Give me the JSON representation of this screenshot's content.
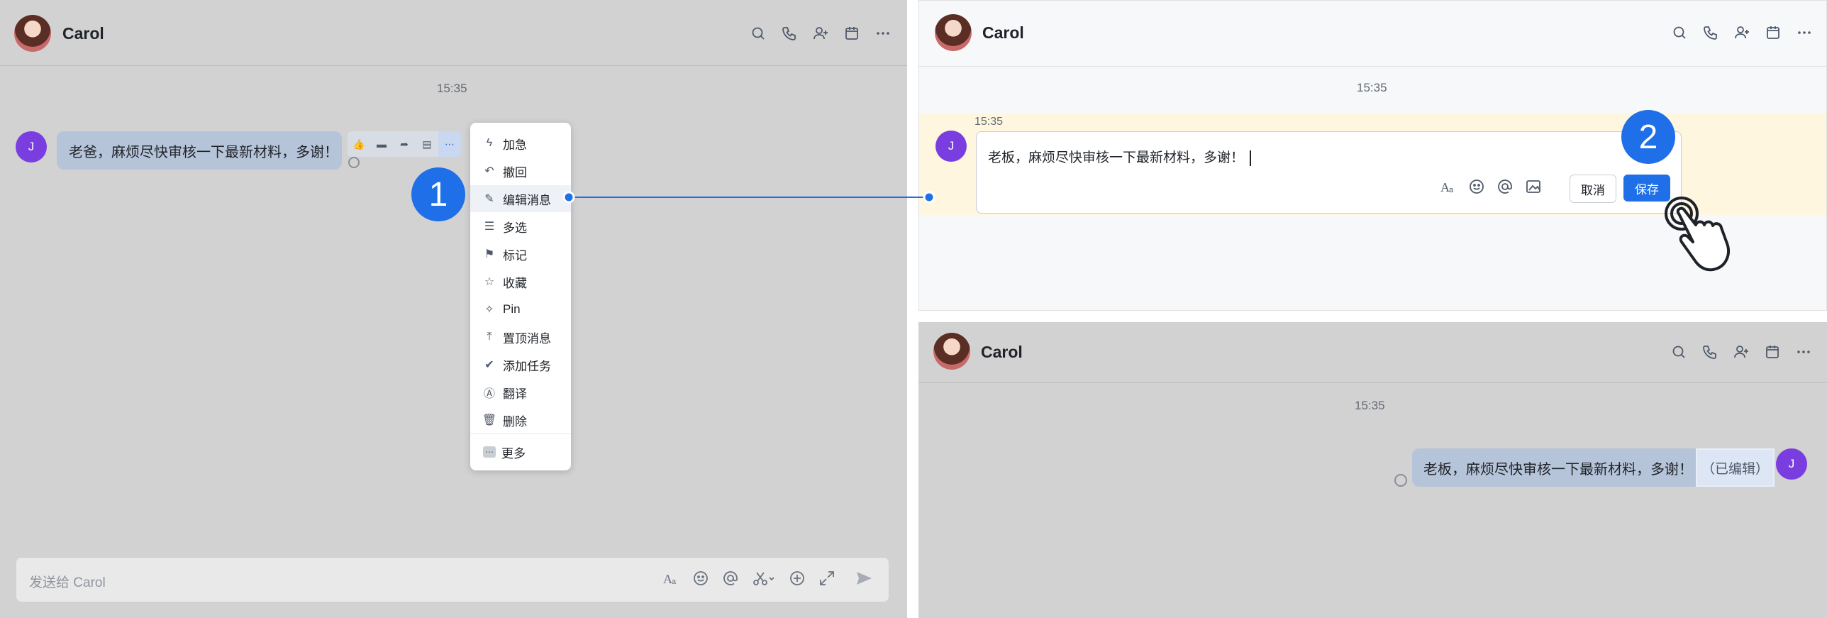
{
  "contact_name": "Carol",
  "time": "15:35",
  "time_small": "15:35",
  "avatar_initial": "J",
  "step_labels": [
    "1",
    "2"
  ],
  "panel1": {
    "message": "老爸，麻烦尽快审核一下最新材料，多谢！",
    "input_placeholder": "发送给 Carol",
    "menu_items": [
      {
        "label": "加急",
        "icon": "lightning-icon"
      },
      {
        "label": "撤回",
        "icon": "undo-icon"
      },
      {
        "label": "编辑消息",
        "icon": "edit-icon",
        "active": true
      },
      {
        "label": "多选",
        "icon": "multiselect-icon"
      },
      {
        "label": "标记",
        "icon": "flag-icon"
      },
      {
        "label": "收藏",
        "icon": "star-icon"
      },
      {
        "label": "Pin",
        "icon": "pin-icon"
      },
      {
        "label": "置顶消息",
        "icon": "pin-top-icon"
      },
      {
        "label": "添加任务",
        "icon": "task-icon"
      },
      {
        "label": "翻译",
        "icon": "translate-icon"
      },
      {
        "label": "删除",
        "icon": "trash-icon"
      }
    ],
    "menu_more": "更多"
  },
  "panel2": {
    "edit_text": "老板，麻烦尽快审核一下最新材料，多谢！",
    "cancel": "取消",
    "save": "保存"
  },
  "panel3": {
    "message": "老板，麻烦尽快审核一下最新材料，多谢！",
    "edited_tag": "（已编辑）"
  },
  "colors": {
    "accent": "#1e6fe8",
    "avatar": "#7a3ee0"
  }
}
